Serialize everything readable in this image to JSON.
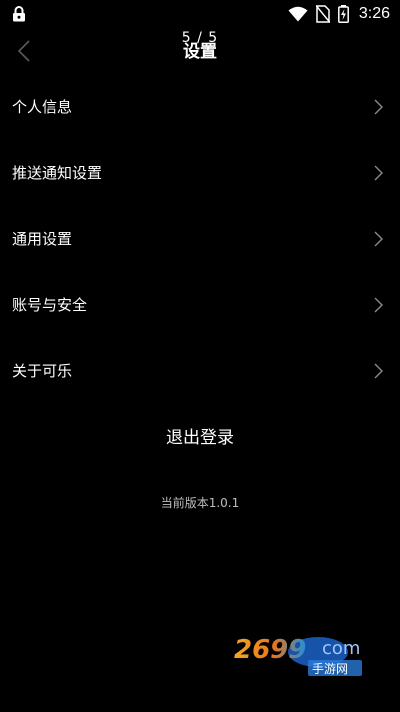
{
  "status_bar": {
    "time": "3:26"
  },
  "header": {
    "counter": "5 / 5",
    "title": "设置"
  },
  "menu": {
    "items": [
      {
        "label": "个人信息"
      },
      {
        "label": "推送通知设置"
      },
      {
        "label": "通用设置"
      },
      {
        "label": "账号与安全"
      },
      {
        "label": "关于可乐"
      }
    ]
  },
  "logout": {
    "label": "退出登录"
  },
  "version": {
    "text": "当前版本1.0.1"
  },
  "watermark": {
    "text": "2699 com 手游网"
  },
  "colors": {
    "background": "#000000",
    "text": "#ffffff",
    "secondary_text": "#bdbdbd",
    "chevron": "#8a8a8a"
  }
}
